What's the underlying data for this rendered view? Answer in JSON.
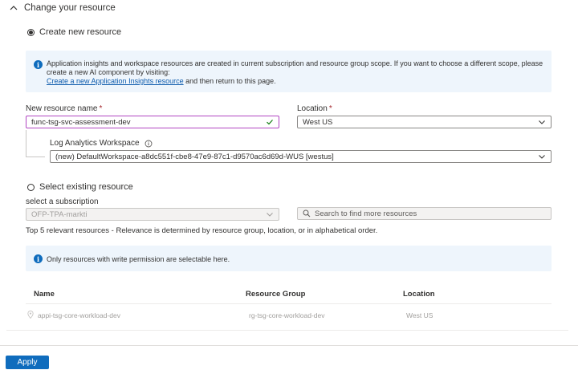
{
  "section": {
    "title": "Change your resource"
  },
  "create_new": {
    "radio_label": "Create new resource",
    "info_text": "Application insights and workspace resources are created in current subscription and resource group scope. If you want to choose a different scope, please create a new AI component by visiting:",
    "info_link": "Create a new Application Insights resource",
    "info_suffix": " and then return to this page.",
    "name_label": "New resource name",
    "name_value": "func-tsg-svc-assessment-dev",
    "location_label": "Location",
    "location_value": "West US",
    "workspace_label": "Log Analytics Workspace",
    "workspace_value": "(new) DefaultWorkspace-a8dc551f-cbe8-47e9-87c1-d9570ac6d69d-WUS [westus]",
    "required_mark": "*"
  },
  "select_existing": {
    "radio_label": "Select existing resource",
    "subscription_label": "select a subscription",
    "subscription_value": "OFP-TPA-markti",
    "search_placeholder": "Search to find more resources",
    "relevance_text": "Top 5 relevant resources - Relevance is determined by resource group, location, or in alphabetical order.",
    "info_text": "Only resources with write permission are selectable here.",
    "table": {
      "columns": [
        "Name",
        "Resource Group",
        "Location"
      ],
      "rows": [
        {
          "name": "appi-tsg-core-workload-dev",
          "group": "rg-tsg-core-workload-dev",
          "location": "West US"
        }
      ]
    }
  },
  "footer": {
    "apply_label": "Apply"
  },
  "colors": {
    "accent": "#0f6cbd",
    "focus_border": "#b146c2",
    "info_bg": "#eef5fc",
    "required": "#a4262c"
  }
}
